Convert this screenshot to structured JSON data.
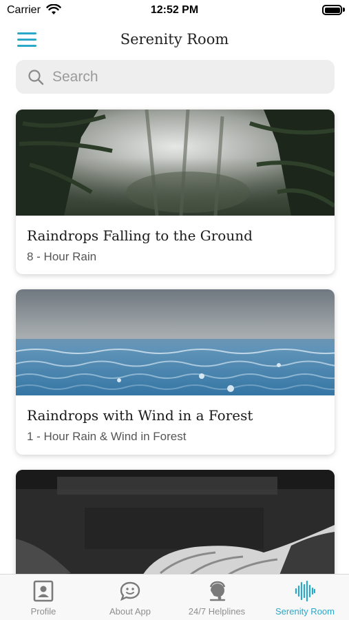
{
  "status_bar": {
    "carrier": "Carrier",
    "time": "12:52 PM"
  },
  "header": {
    "title": "Serenity Room",
    "menu_icon": "hamburger-menu-icon"
  },
  "search": {
    "placeholder": "Search",
    "value": "",
    "icon": "search-icon"
  },
  "cards": [
    {
      "title": "Raindrops Falling to the Ground",
      "subtitle": "8 - Hour Rain",
      "image": "misty-forest-photo"
    },
    {
      "title": "Raindrops with Wind in a Forest",
      "subtitle": "1 - Hour Rain & Wind in Forest",
      "image": "rain-on-water-photo"
    },
    {
      "title": "",
      "subtitle": "",
      "image": "piano-hands-photo"
    }
  ],
  "tabs": [
    {
      "label": "Profile",
      "icon": "profile-icon",
      "active": false
    },
    {
      "label": "About App",
      "icon": "chat-smile-icon",
      "active": false
    },
    {
      "label": "24/7 Helplines",
      "icon": "headset-icon",
      "active": false
    },
    {
      "label": "Serenity Room",
      "icon": "sound-wave-icon",
      "active": true
    }
  ],
  "colors": {
    "accent": "#2aa7c9",
    "inactive": "#8e8e8e",
    "search_bg": "#eeeeee"
  }
}
